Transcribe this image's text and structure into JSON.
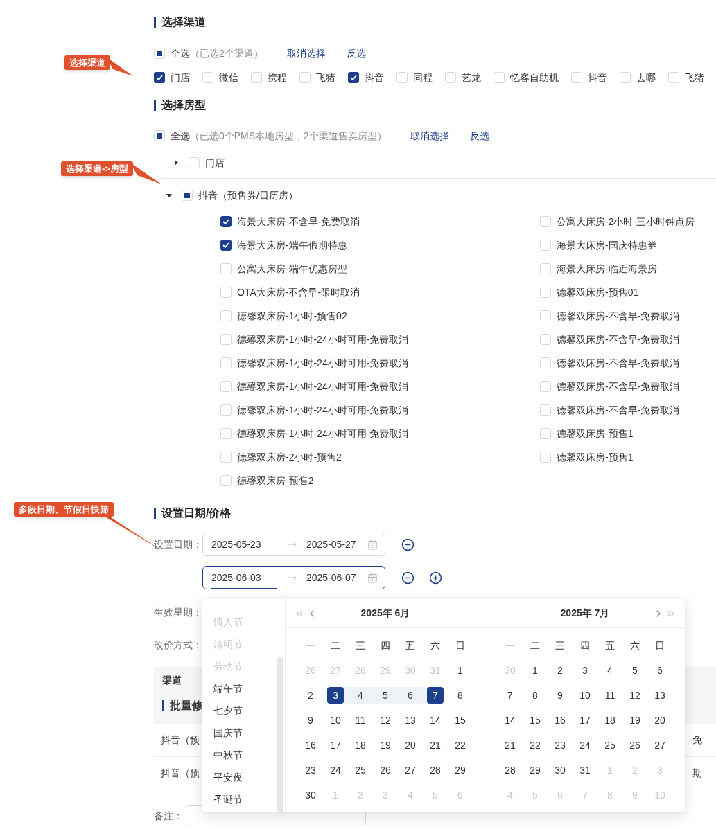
{
  "annotations": [
    {
      "text": "选择渠道"
    },
    {
      "text": "选择渠道->房型"
    },
    {
      "text": "多段日期、节假日快筛"
    }
  ],
  "channel_section": {
    "title": "选择渠道",
    "select_all": {
      "label": "全选",
      "note": "（已选2个渠道）",
      "indeterminate": true
    },
    "actions": [
      "取消选择",
      "反选"
    ],
    "channels": [
      {
        "label": "门店",
        "checked": true
      },
      {
        "label": "微信",
        "checked": false
      },
      {
        "label": "携程",
        "checked": false
      },
      {
        "label": "飞猪",
        "checked": false
      },
      {
        "label": "抖音",
        "checked": true
      },
      {
        "label": "同程",
        "checked": false
      },
      {
        "label": "艺龙",
        "checked": false
      },
      {
        "label": "忆客自助机",
        "checked": false
      },
      {
        "label": "抖音",
        "checked": false
      },
      {
        "label": "去哪",
        "checked": false
      },
      {
        "label": "飞猪",
        "checked": false
      }
    ]
  },
  "room_section": {
    "title": "选择房型",
    "select_all": {
      "label": "全选",
      "note": "（已选0个PMS本地房型，2个渠道售卖房型）",
      "indeterminate": true
    },
    "actions": [
      "取消选择",
      "反选"
    ],
    "groups": [
      {
        "label": "门店",
        "expanded": false,
        "checked": false,
        "indeterminate": false
      },
      {
        "label": "抖音（预售券/日历房）",
        "expanded": true,
        "checked": false,
        "indeterminate": true,
        "rooms": [
          {
            "label": "海景大床房-不含早-免费取消",
            "checked": true
          },
          {
            "label": "公寓大床房-2小时-三小时钟点房",
            "checked": false
          },
          {
            "label": "海景大床房-端午假期特惠",
            "checked": true
          },
          {
            "label": "海景大床房-国庆特惠券",
            "checked": false
          },
          {
            "label": "公寓大床房-端午优惠房型",
            "checked": false
          },
          {
            "label": "海景大床房-临近海景房",
            "checked": false
          },
          {
            "label": "OTA大床房-不含早-限时取消",
            "checked": false
          },
          {
            "label": "德馨双床房-预售01",
            "checked": false
          },
          {
            "label": "德馨双床房-1小时-预售02",
            "checked": false
          },
          {
            "label": "德馨双床房-不含早-免费取消",
            "checked": false
          },
          {
            "label": "德馨双床房-1小时-24小时可用-免费取消",
            "checked": false
          },
          {
            "label": "德馨双床房-不含早-免费取消",
            "checked": false
          },
          {
            "label": "德馨双床房-1小时-24小时可用-免费取消",
            "checked": false
          },
          {
            "label": "德馨双床房-不含早-免费取消",
            "checked": false
          },
          {
            "label": "德馨双床房-1小时-24小时可用-免费取消",
            "checked": false
          },
          {
            "label": "德馨双床房-不含早-免费取消",
            "checked": false
          },
          {
            "label": "德馨双床房-1小时-24小时可用-免费取消",
            "checked": false
          },
          {
            "label": "德馨双床房-不含早-免费取消",
            "checked": false
          },
          {
            "label": "德馨双床房-1小时-24小时可用-免费取消",
            "checked": false
          },
          {
            "label": "德馨双床房-预售1",
            "checked": false
          },
          {
            "label": "德馨双床房-2小时-预售2",
            "checked": false
          },
          {
            "label": "德馨双床房-预售1",
            "checked": false
          },
          {
            "label": "德馨双床房-预售2",
            "checked": false
          }
        ]
      }
    ]
  },
  "date_section": {
    "title": "设置日期/价格",
    "label": "设置日期：",
    "ranges": [
      {
        "start": "2025-05-23",
        "end": "2025-05-27",
        "focused": false,
        "show_add": false
      },
      {
        "start": "2025-06-03",
        "end": "2025-06-07",
        "focused": true,
        "show_add": true
      }
    ],
    "weekday_label": "生效星期：",
    "price_mode_label": "改价方式：",
    "table": {
      "header": "渠道",
      "subheader": "批量修",
      "rows": [
        {
          "channel": "抖音（预",
          "tail": "-免"
        },
        {
          "channel": "抖音（预",
          "tail": "期"
        }
      ]
    },
    "remark_label": "备注："
  },
  "picker": {
    "holidays": [
      {
        "label": "情人节",
        "disabled": true
      },
      {
        "label": "清明节",
        "disabled": true
      },
      {
        "label": "劳动节",
        "disabled": true
      },
      {
        "label": "端午节",
        "disabled": false
      },
      {
        "label": "七夕节",
        "disabled": false
      },
      {
        "label": "国庆节",
        "disabled": false
      },
      {
        "label": "中秋节",
        "disabled": false
      },
      {
        "label": "平安夜",
        "disabled": false
      },
      {
        "label": "圣诞节",
        "disabled": false
      }
    ],
    "months": [
      {
        "title": "2025年 6月",
        "weekdays": [
          "一",
          "二",
          "三",
          "四",
          "五",
          "六",
          "日"
        ],
        "days": [
          {
            "label": "26",
            "kind": "other"
          },
          {
            "label": "27",
            "kind": "other"
          },
          {
            "label": "28",
            "kind": "other"
          },
          {
            "label": "29",
            "kind": "other"
          },
          {
            "label": "30",
            "kind": "other"
          },
          {
            "label": "31",
            "kind": "other"
          },
          {
            "label": "1",
            "kind": "normal"
          },
          {
            "label": "2",
            "kind": "normal"
          },
          {
            "label": "3",
            "kind": "start"
          },
          {
            "label": "4",
            "kind": "range"
          },
          {
            "label": "5",
            "kind": "range"
          },
          {
            "label": "6",
            "kind": "range"
          },
          {
            "label": "7",
            "kind": "end"
          },
          {
            "label": "8",
            "kind": "normal"
          },
          {
            "label": "9",
            "kind": "normal"
          },
          {
            "label": "10",
            "kind": "normal"
          },
          {
            "label": "11",
            "kind": "normal"
          },
          {
            "label": "12",
            "kind": "normal"
          },
          {
            "label": "13",
            "kind": "normal"
          },
          {
            "label": "14",
            "kind": "normal"
          },
          {
            "label": "15",
            "kind": "normal"
          },
          {
            "label": "16",
            "kind": "normal"
          },
          {
            "label": "17",
            "kind": "normal"
          },
          {
            "label": "18",
            "kind": "normal"
          },
          {
            "label": "19",
            "kind": "normal"
          },
          {
            "label": "20",
            "kind": "normal"
          },
          {
            "label": "21",
            "kind": "normal"
          },
          {
            "label": "22",
            "kind": "normal"
          },
          {
            "label": "23",
            "kind": "normal"
          },
          {
            "label": "24",
            "kind": "normal"
          },
          {
            "label": "25",
            "kind": "normal"
          },
          {
            "label": "26",
            "kind": "normal"
          },
          {
            "label": "27",
            "kind": "normal"
          },
          {
            "label": "28",
            "kind": "normal"
          },
          {
            "label": "29",
            "kind": "normal"
          },
          {
            "label": "30",
            "kind": "normal"
          },
          {
            "label": "1",
            "kind": "other"
          },
          {
            "label": "2",
            "kind": "other"
          },
          {
            "label": "3",
            "kind": "other"
          },
          {
            "label": "4",
            "kind": "other"
          },
          {
            "label": "5",
            "kind": "other"
          },
          {
            "label": "6",
            "kind": "other"
          }
        ]
      },
      {
        "title": "2025年 7月",
        "weekdays": [
          "一",
          "二",
          "三",
          "四",
          "五",
          "六",
          "日"
        ],
        "days": [
          {
            "label": "30",
            "kind": "other"
          },
          {
            "label": "1",
            "kind": "normal"
          },
          {
            "label": "2",
            "kind": "normal"
          },
          {
            "label": "3",
            "kind": "normal"
          },
          {
            "label": "4",
            "kind": "normal"
          },
          {
            "label": "5",
            "kind": "normal"
          },
          {
            "label": "6",
            "kind": "normal"
          },
          {
            "label": "7",
            "kind": "normal"
          },
          {
            "label": "8",
            "kind": "normal"
          },
          {
            "label": "9",
            "kind": "normal"
          },
          {
            "label": "10",
            "kind": "normal"
          },
          {
            "label": "11",
            "kind": "normal"
          },
          {
            "label": "12",
            "kind": "normal"
          },
          {
            "label": "13",
            "kind": "normal"
          },
          {
            "label": "14",
            "kind": "normal"
          },
          {
            "label": "15",
            "kind": "normal"
          },
          {
            "label": "16",
            "kind": "normal"
          },
          {
            "label": "17",
            "kind": "normal"
          },
          {
            "label": "18",
            "kind": "normal"
          },
          {
            "label": "19",
            "kind": "normal"
          },
          {
            "label": "20",
            "kind": "normal"
          },
          {
            "label": "21",
            "kind": "normal"
          },
          {
            "label": "22",
            "kind": "normal"
          },
          {
            "label": "23",
            "kind": "normal"
          },
          {
            "label": "24",
            "kind": "normal"
          },
          {
            "label": "25",
            "kind": "normal"
          },
          {
            "label": "26",
            "kind": "normal"
          },
          {
            "label": "27",
            "kind": "normal"
          },
          {
            "label": "28",
            "kind": "normal"
          },
          {
            "label": "29",
            "kind": "normal"
          },
          {
            "label": "30",
            "kind": "normal"
          },
          {
            "label": "31",
            "kind": "normal"
          },
          {
            "label": "1",
            "kind": "other"
          },
          {
            "label": "2",
            "kind": "other"
          },
          {
            "label": "3",
            "kind": "other"
          },
          {
            "label": "4",
            "kind": "other"
          },
          {
            "label": "5",
            "kind": "other"
          },
          {
            "label": "6",
            "kind": "other"
          },
          {
            "label": "7",
            "kind": "other"
          },
          {
            "label": "8",
            "kind": "other"
          },
          {
            "label": "9",
            "kind": "other"
          },
          {
            "label": "10",
            "kind": "other"
          }
        ]
      }
    ]
  }
}
